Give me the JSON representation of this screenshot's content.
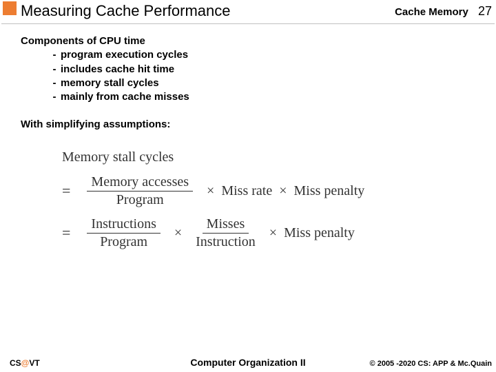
{
  "header": {
    "title": "Measuring Cache Performance",
    "section": "Cache Memory",
    "page": "27"
  },
  "content": {
    "heading1": "Components of CPU time",
    "bullets": [
      "program execution cycles",
      "includes cache hit time",
      "memory stall cycles",
      "mainly from cache misses"
    ],
    "heading2": "With simplifying assumptions:"
  },
  "formula": {
    "line1": "Memory stall cycles",
    "eq": "=",
    "times": "×",
    "frac1_num": "Memory accesses",
    "frac1_den": "Program",
    "term_missrate": "Miss rate",
    "term_misspenalty": "Miss penalty",
    "frac2_num": "Instructions",
    "frac2_den": "Program",
    "frac3_num": "Misses",
    "frac3_den": "Instruction"
  },
  "footer": {
    "left_cs": "CS",
    "left_at": "@",
    "left_vt": "VT",
    "center": "Computer Organization II",
    "right": "© 2005 -2020 CS: APP & Mc.Quain"
  }
}
